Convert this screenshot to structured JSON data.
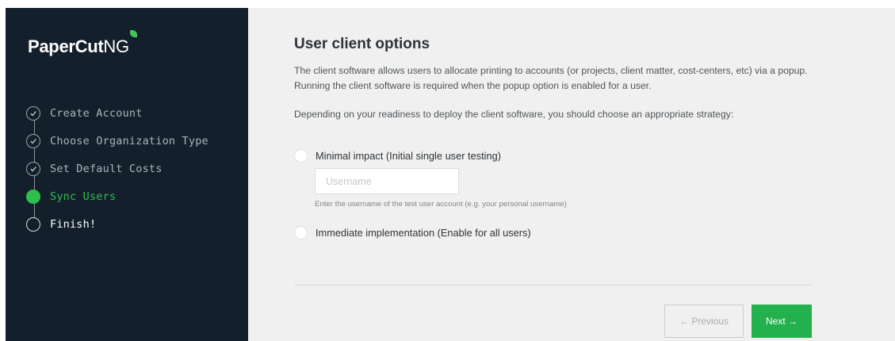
{
  "brand": {
    "name": "PaperCut",
    "suffix": "NG",
    "accent_color": "#49c15a"
  },
  "sidebar": {
    "background": "#13202c",
    "steps": [
      {
        "label": "Create Account",
        "state": "done",
        "icon": "check-circle-icon"
      },
      {
        "label": "Choose Organization Type",
        "state": "done",
        "icon": "check-circle-icon"
      },
      {
        "label": "Set Default Costs",
        "state": "done",
        "icon": "check-circle-icon"
      },
      {
        "label": "Sync Users",
        "state": "active",
        "icon": "filled-circle-icon"
      },
      {
        "label": "Finish!",
        "state": "pending",
        "icon": "empty-circle-icon"
      }
    ]
  },
  "main": {
    "title": "User client options",
    "paragraph1": "The client software allows users to allocate printing to accounts (or projects, client matter, cost-centers, etc) via a popup. Running the client software is required when the popup option is enabled for a user.",
    "paragraph2": "Depending on your readiness to deploy the client software, you should choose an appropriate strategy:",
    "options": [
      {
        "label": "Minimal impact (Initial single user testing)",
        "selected": false
      },
      {
        "label": "Immediate implementation (Enable for all users)",
        "selected": false
      }
    ],
    "username": {
      "value": "",
      "placeholder": "Username",
      "hint": "Enter the username of the test user account (e.g. your personal username)"
    }
  },
  "buttons": {
    "previous": "← Previous",
    "next": "Next →",
    "next_color": "#23b14d"
  }
}
